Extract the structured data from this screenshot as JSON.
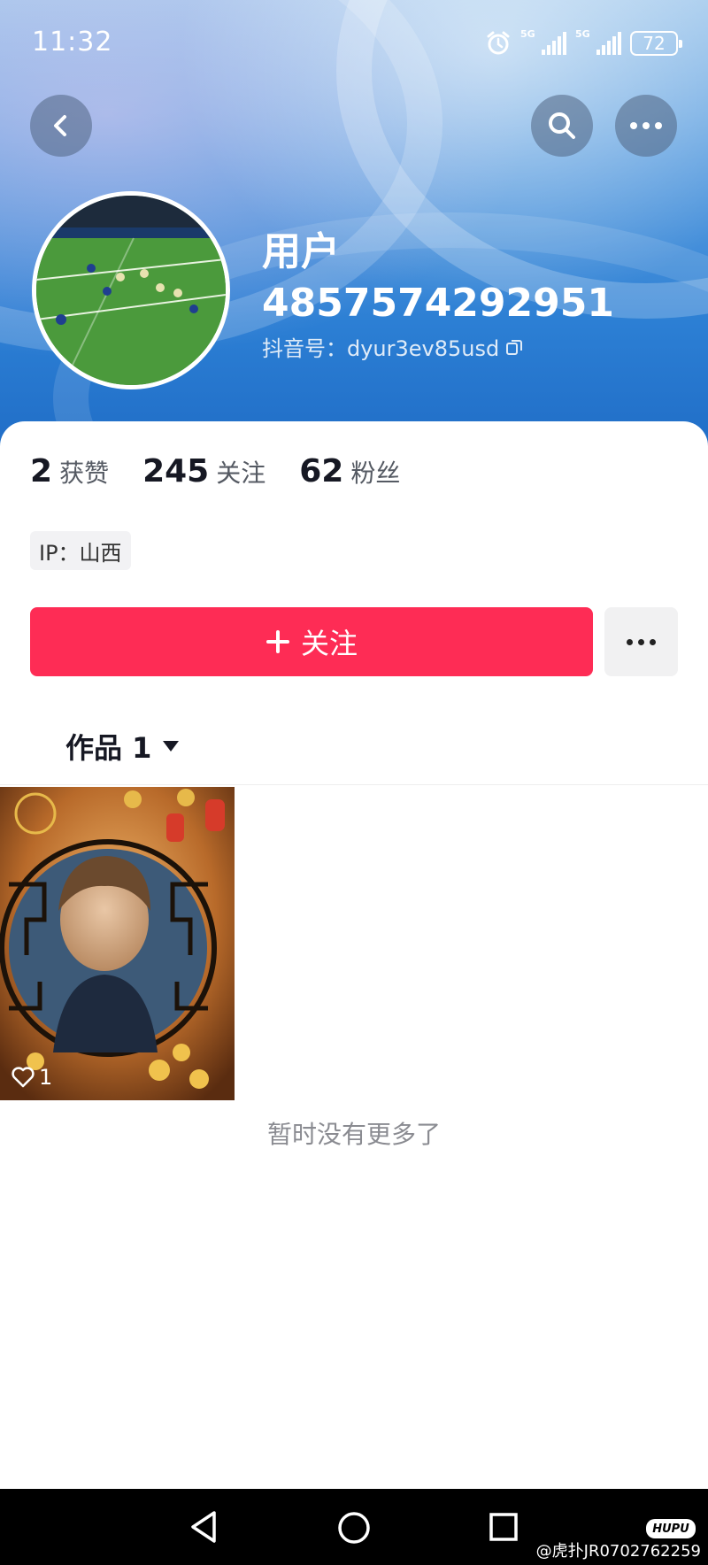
{
  "status_bar": {
    "time": "11:32",
    "network_1": "5G",
    "network_2": "5G",
    "battery": "72"
  },
  "profile": {
    "name_line1": "用户",
    "name_line2": "4857574292951",
    "douyin_id": "抖音号：dyur3ev85usd"
  },
  "stats": [
    {
      "value": "2",
      "label": "获赞"
    },
    {
      "value": "245",
      "label": "关注"
    },
    {
      "value": "62",
      "label": "粉丝"
    }
  ],
  "ip_location": "IP：山西",
  "follow_button": {
    "label": "关注"
  },
  "works_tab": {
    "label": "作品 1"
  },
  "video": {
    "likes": "1"
  },
  "no_more_text": "暂时没有更多了",
  "watermark": {
    "brand": "HUPU",
    "text": "@虎扑JR0702762259"
  },
  "colors": {
    "accent": "#fe2c55",
    "text": "#161823",
    "muted": "#8a8b91"
  }
}
